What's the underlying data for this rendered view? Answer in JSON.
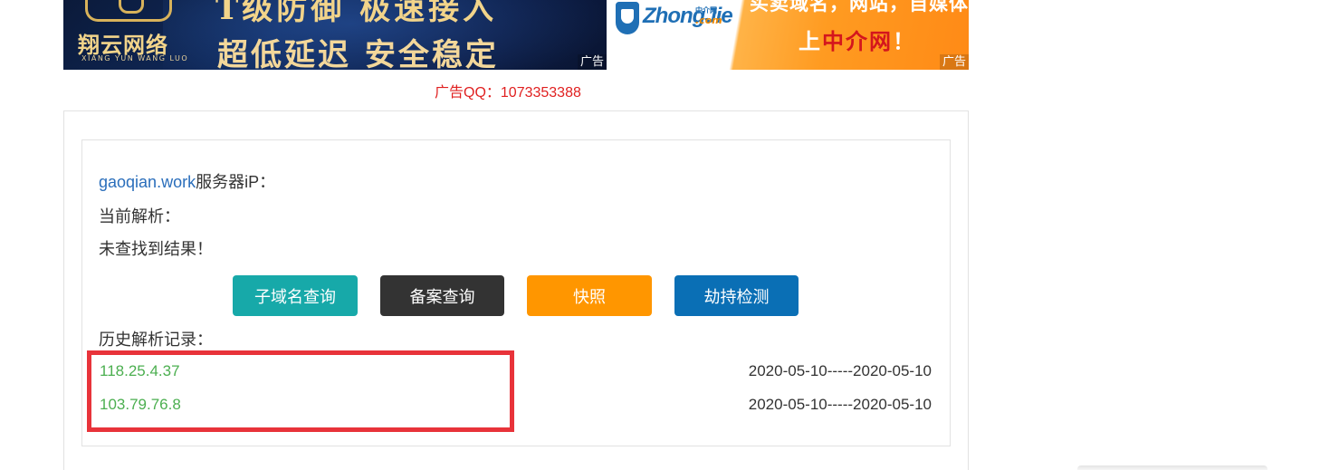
{
  "ads": {
    "left": {
      "brand": "翔云网络",
      "brand_sub": "XIANG YUN WANG LUO",
      "top_line": "T级防御  极速接入",
      "main_line": "超低延迟  安全稳定",
      "tag": "广告"
    },
    "right": {
      "logo": "ZhongJie",
      "logo_sup": "中介网",
      "logo_com": ".com",
      "slogan_top": "买卖域名，网站，自媒体",
      "slogan_pre": "上",
      "slogan_highlight": "中介网",
      "slogan_post": "！",
      "tag": "广告"
    },
    "contact": "广告QQ：1073353388"
  },
  "result": {
    "domain": "gaoqian.work",
    "server_ip_label": "服务器iP：",
    "current_resolution_label": "当前解析：",
    "no_result": "未查找到结果！",
    "history_label": "历史解析记录："
  },
  "actions": {
    "subdomain": "子域名查询",
    "icp": "备案查询",
    "snapshot": "快照",
    "hijack": "劫持检测"
  },
  "history": [
    {
      "ip": "118.25.4.37",
      "range": "2020-05-10-----2020-05-10"
    },
    {
      "ip": "103.79.76.8",
      "range": "2020-05-10-----2020-05-10"
    }
  ],
  "colors": {
    "subdomain_button": "#17a9a9",
    "icp_button": "#333333",
    "snapshot_button": "#ff9600",
    "hijack_button": "#0a6fb5",
    "ip_text": "#4caf50",
    "highlight_border": "#e8333a",
    "domain_link": "#2a6ebb"
  }
}
